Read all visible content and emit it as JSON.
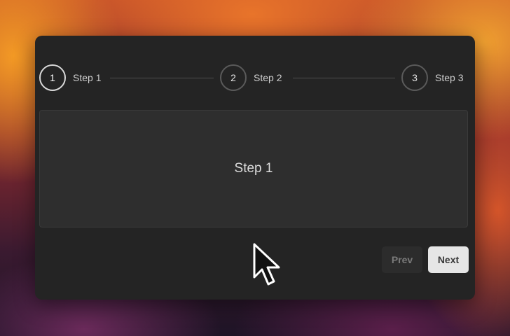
{
  "stepper": {
    "steps": [
      {
        "number": "1",
        "label": "Step 1",
        "active": true
      },
      {
        "number": "2",
        "label": "Step 2",
        "active": false
      },
      {
        "number": "3",
        "label": "Step 3",
        "active": false
      }
    ]
  },
  "content": {
    "text": "Step 1"
  },
  "controls": {
    "prev_label": "Prev",
    "next_label": "Next"
  },
  "cursor": {
    "icon": "arrow-pointer-icon"
  },
  "colors": {
    "panel_bg": "#242424",
    "content_bg": "#2e2e2e",
    "active_ring": "#d8d8d8",
    "inactive_ring": "#5a5a5a",
    "next_button_bg": "#e6e6e6"
  }
}
